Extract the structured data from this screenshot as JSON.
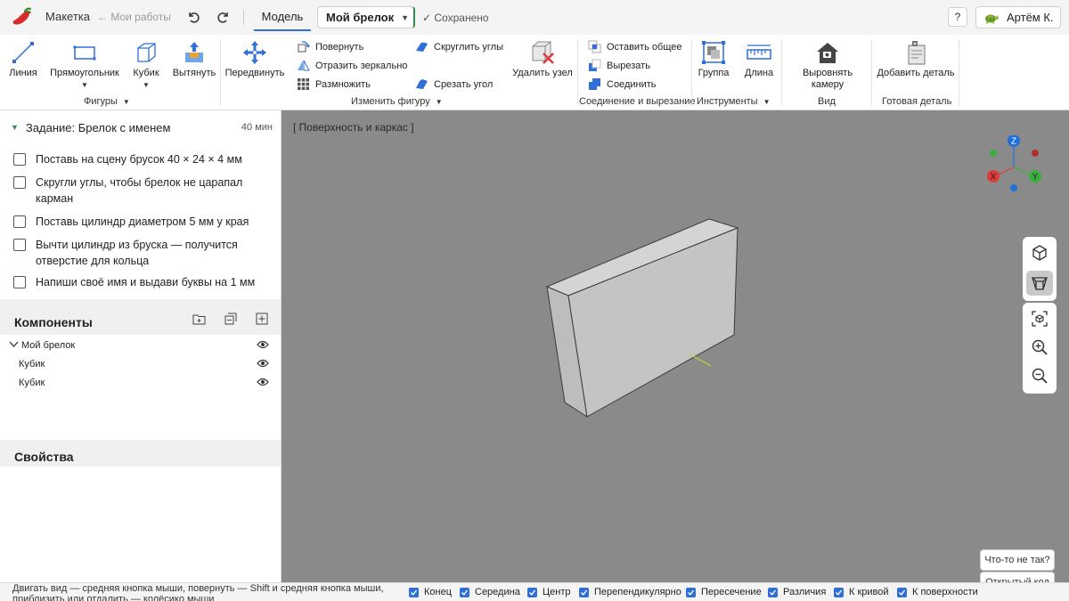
{
  "topbar": {
    "app_name": "Макетка",
    "back_link": "← Мои работы",
    "tab_model": "Модель",
    "project_name": "Мой брелок",
    "saved_status": "✓ Сохранено",
    "help": "?",
    "user_name": "Артём К."
  },
  "ribbon": {
    "figures": {
      "line": "Линия",
      "rectangle": "Прямоугольник",
      "cube": "Кубик",
      "extrude": "Вытянуть",
      "group_label": "Фигуры"
    },
    "modify": {
      "move": "Передвинуть",
      "rotate": "Повернуть",
      "mirror": "Отразить зеркально",
      "multiply": "Размножить",
      "round_corners": "Скруглить углы",
      "chamfer": "Срезать угол",
      "delete_node": "Удалить узел",
      "group_label": "Изменить фигуру"
    },
    "boolean": {
      "intersect": "Оставить общее",
      "subtract": "Вырезать",
      "union": "Соединить",
      "group_label": "Соединение и вырезание"
    },
    "tools": {
      "group": "Группа",
      "length": "Длина",
      "group_label": "Инструменты"
    },
    "view": {
      "align_camera": "Выровнять камеру",
      "group_label": "Вид"
    },
    "ready": {
      "add_part": "Добавить деталь",
      "group_label": "Готовая деталь"
    }
  },
  "task": {
    "title": "Задание: Брелок с именем",
    "duration": "40 мин",
    "steps": [
      "Поставь на сцену брусок 40 × 24 × 4 мм",
      "Скругли углы, чтобы брелок не царапал карман",
      "Поставь цилиндр диаметром 5 мм у края",
      "Вычти цилиндр из бруска — получится отверстие для кольца",
      "Напиши своё имя и выдави буквы на 1 мм"
    ]
  },
  "components": {
    "title": "Компоненты",
    "tree": [
      {
        "label": "Мой брелок"
      },
      {
        "label": "Кубик"
      },
      {
        "label": "Кубик"
      }
    ]
  },
  "properties": {
    "title": "Свойства"
  },
  "viewport": {
    "mode_label": "[ Поверхность и каркас ]",
    "axes": {
      "z": "Z",
      "x": "X",
      "y": "Y"
    },
    "feedback_button": "Что-то не так?",
    "open_code_button": "Открытый код"
  },
  "statusbar": {
    "hint": "Двигать вид — средняя кнопка мыши, повернуть — Shift и средняя кнопка мыши, приблизить или отдалить — колёсико мыши",
    "snaps": [
      "Конец",
      "Середина",
      "Центр",
      "Перепендикулярно",
      "Пересечение",
      "Различия",
      "К кривой",
      "К поверхности"
    ]
  },
  "colors": {
    "accent": "#2f6fd6",
    "saved_green": "#2f8a4c",
    "viewport_bg": "#8a8a8a",
    "axis_z": "#1e6fd9",
    "axis_x": "#e03a3a",
    "axis_y": "#3cae3c"
  }
}
